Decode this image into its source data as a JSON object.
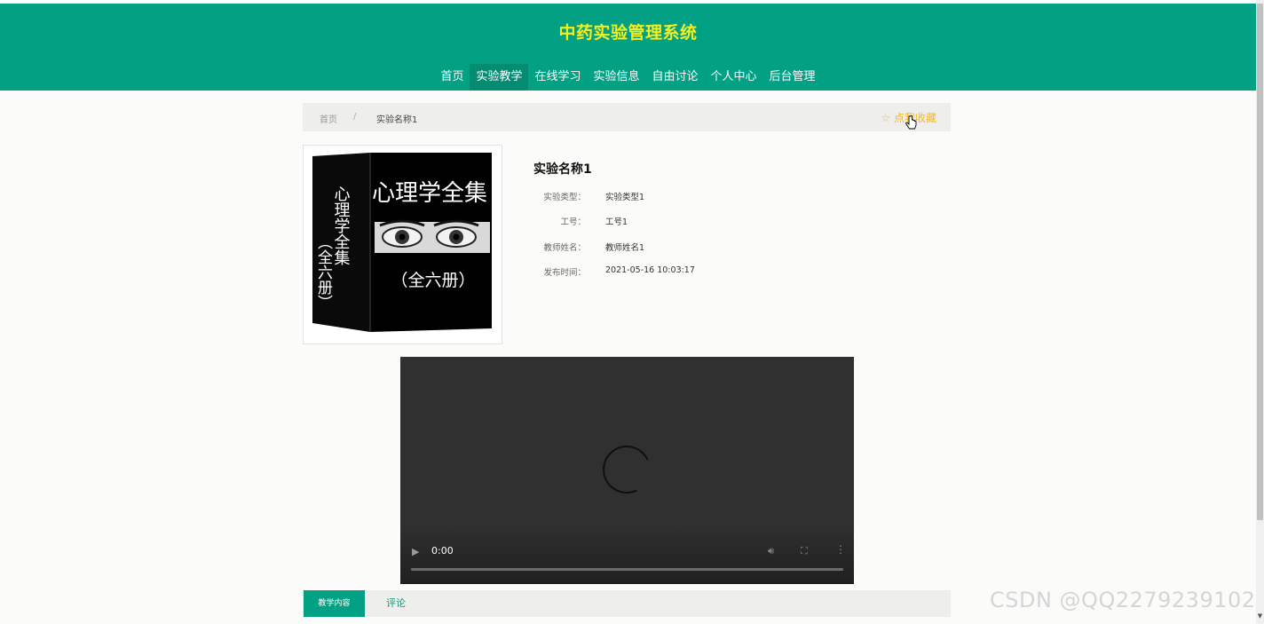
{
  "site": {
    "title": "中药实验管理系统"
  },
  "nav": {
    "items": [
      {
        "label": "首页"
      },
      {
        "label": "实验教学",
        "active": true
      },
      {
        "label": "在线学习"
      },
      {
        "label": "实验信息"
      },
      {
        "label": "自由讨论"
      },
      {
        "label": "个人中心"
      },
      {
        "label": "后台管理"
      }
    ]
  },
  "breadcrumb": {
    "home": "首页",
    "separator": "/",
    "current": "实验名称1"
  },
  "favorite": {
    "label": "☆ 点我收藏"
  },
  "cover": {
    "spine_text": "心理学全集（全六册）",
    "front_title": "心理学全集",
    "front_subtitle": "（全六册）"
  },
  "detail": {
    "title": "实验名称1",
    "fields": [
      {
        "label": "实验类型：",
        "value": "实验类型1"
      },
      {
        "label": "工号：",
        "value": "工号1"
      },
      {
        "label": "教师姓名：",
        "value": "教师姓名1"
      },
      {
        "label": "发布时间：",
        "value": "2021-05-16 10:03:17"
      }
    ]
  },
  "video": {
    "time": "0:00"
  },
  "tabs": [
    {
      "label": "教学内容",
      "active": true
    },
    {
      "label": "评论"
    }
  ],
  "watermark": "CSDN @QQ2279239102",
  "colors": {
    "brand": "#03a184",
    "brand_dark": "#058b71",
    "title": "#f5ef1c",
    "favorite": "#f0b929"
  }
}
